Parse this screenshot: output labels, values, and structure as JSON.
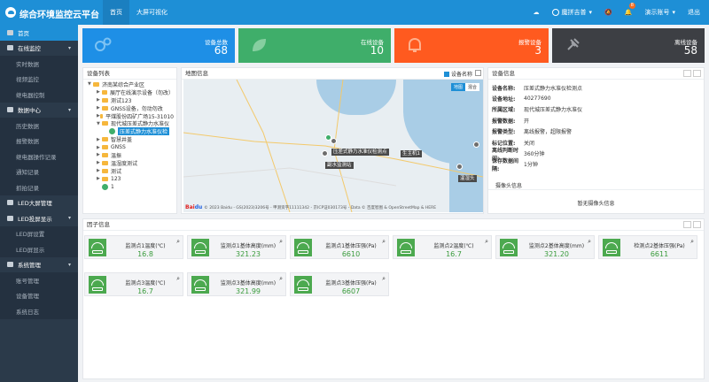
{
  "header": {
    "title": "综合环境监控云平台",
    "nav": [
      "首页",
      "大屏可视化"
    ],
    "right": {
      "lang": "魔拼吉普",
      "notif_count": "8",
      "account": "演示账号",
      "logout": "退出"
    }
  },
  "sidebar": {
    "items": [
      {
        "label": "首页",
        "type": "group"
      },
      {
        "label": "在线监控",
        "type": "group"
      },
      {
        "label": "实时数据",
        "type": "sub"
      },
      {
        "label": "视频监控",
        "type": "sub"
      },
      {
        "label": "继电器控制",
        "type": "sub"
      },
      {
        "label": "数据中心",
        "type": "group"
      },
      {
        "label": "历史数据",
        "type": "sub"
      },
      {
        "label": "报警数据",
        "type": "sub"
      },
      {
        "label": "继电器操作记录",
        "type": "sub"
      },
      {
        "label": "通知记录",
        "type": "sub"
      },
      {
        "label": "抓拍记录",
        "type": "sub"
      },
      {
        "label": "LED大屏管理",
        "type": "group"
      },
      {
        "label": "LED投屏显示",
        "type": "group"
      },
      {
        "label": "LED屏设置",
        "type": "sub"
      },
      {
        "label": "LED屏显示",
        "type": "sub"
      },
      {
        "label": "系统管理",
        "type": "group"
      },
      {
        "label": "账号管理",
        "type": "sub"
      },
      {
        "label": "设备管理",
        "type": "sub"
      },
      {
        "label": "系统日志",
        "type": "sub"
      }
    ]
  },
  "stats": [
    {
      "label": "设备总数",
      "value": "68",
      "color": "#1e8fe6"
    },
    {
      "label": "在线设备",
      "value": "10",
      "color": "#3fae6a"
    },
    {
      "label": "报警设备",
      "value": "3",
      "color": "#ff5a1f"
    },
    {
      "label": "离线设备",
      "value": "58",
      "color": "#3d3f44"
    }
  ],
  "device_list": {
    "title": "设备列表",
    "tree": [
      {
        "label": "济南某综合产业区",
        "level": 0,
        "expanded": true
      },
      {
        "label": "展厅在线演示设备（勿改）",
        "level": 1
      },
      {
        "label": "测试123",
        "level": 1
      },
      {
        "label": "GNSS设备，勿动勿改",
        "level": 1
      },
      {
        "label": "平煤股份四矿广场15-31010",
        "level": 1
      },
      {
        "label": "现代城压差式静力水准仪",
        "level": 1,
        "expanded": true
      },
      {
        "label": "压差式静力水准仪检",
        "level": 2,
        "selected": true
      },
      {
        "label": "智慧井盖",
        "level": 1
      },
      {
        "label": "GNSS",
        "level": 1
      },
      {
        "label": "温振",
        "level": 1
      },
      {
        "label": "温湿度测试",
        "level": 1
      },
      {
        "label": "测试",
        "level": 1
      },
      {
        "label": "123",
        "level": 1
      },
      {
        "label": "1",
        "level": 1,
        "leaf": true
      }
    ]
  },
  "map": {
    "title": "地图信息",
    "device_name_label": "设备名称",
    "type_map": "地图",
    "type_sat": "混合",
    "labels": [
      "压差式静力水准仪检测点",
      "生主机1",
      "副水监测站",
      "温湿头"
    ],
    "copyright": "© 2023 Baidu - GS(2023)3206号 - 甲测资字11111342 - 京ICP证030173号 - Data © 百度智图 & OpenStreetMap & HERE"
  },
  "device_info": {
    "title": "设备信息",
    "rows": [
      {
        "k": "设备名称:",
        "v": "压差式静力水准仪检测点"
      },
      {
        "k": "设备地址:",
        "v": "40277690"
      },
      {
        "k": "所属区域:",
        "v": "现代城压差式静力水准仪"
      },
      {
        "k": "报警数据:",
        "v": "开"
      },
      {
        "k": "报警类型:",
        "v": "离线报警，超限报警"
      },
      {
        "k": "标记位置:",
        "v": "关闭"
      },
      {
        "k": "离线判断时间:",
        "v": "360分钟"
      },
      {
        "k": "保存数据间隔:",
        "v": "1分钟"
      }
    ],
    "camera_title": "摄像头信息",
    "camera_empty": "暂无摄像头信息"
  },
  "factors": {
    "title": "因子信息",
    "cards": [
      {
        "name": "监测点1温度(℃)",
        "value": "16.8"
      },
      {
        "name": "监测点1基体高度(mm)",
        "value": "321.23"
      },
      {
        "name": "监测点1基体压强(Pa)",
        "value": "6610"
      },
      {
        "name": "监测点2温度(℃)",
        "value": "16.7"
      },
      {
        "name": "监测点2基体高度(mm)",
        "value": "321.20"
      },
      {
        "name": "检测点2基体压强(Pa)",
        "value": "6611"
      },
      {
        "name": "监测点3温度(℃)",
        "value": "16.7"
      },
      {
        "name": "监测点3基体高度(mm)",
        "value": "321.99"
      },
      {
        "name": "监测点3基体压强(Pa)",
        "value": "6607"
      }
    ]
  }
}
